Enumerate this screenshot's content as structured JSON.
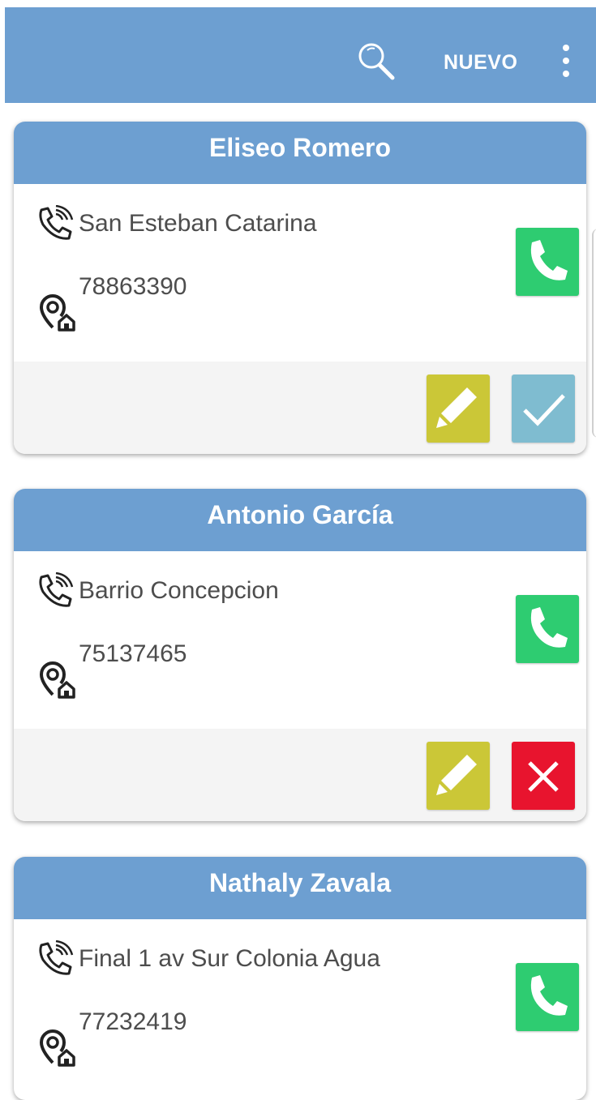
{
  "toolbar": {
    "search_icon": "search-icon",
    "new_label": "NUEVO",
    "menu_icon": "more-vert-icon",
    "bg_color": "#6d9fd1"
  },
  "contacts": [
    {
      "name": "Eliseo Romero",
      "address": "San Esteban Catarina",
      "phone": "78863390",
      "status": "check",
      "status_color": "#7fbcd0"
    },
    {
      "name": "Antonio García",
      "address": "Barrio Concepcion",
      "phone": "75137465",
      "status": "cancel",
      "status_color": "#e8142e"
    },
    {
      "name": "Nathaly Zavala",
      "address": "Final 1 av Sur Colonia Agua",
      "phone": "77232419"
    }
  ],
  "colors": {
    "call_button": "#2ecc71",
    "edit_button": "#cbc737"
  }
}
